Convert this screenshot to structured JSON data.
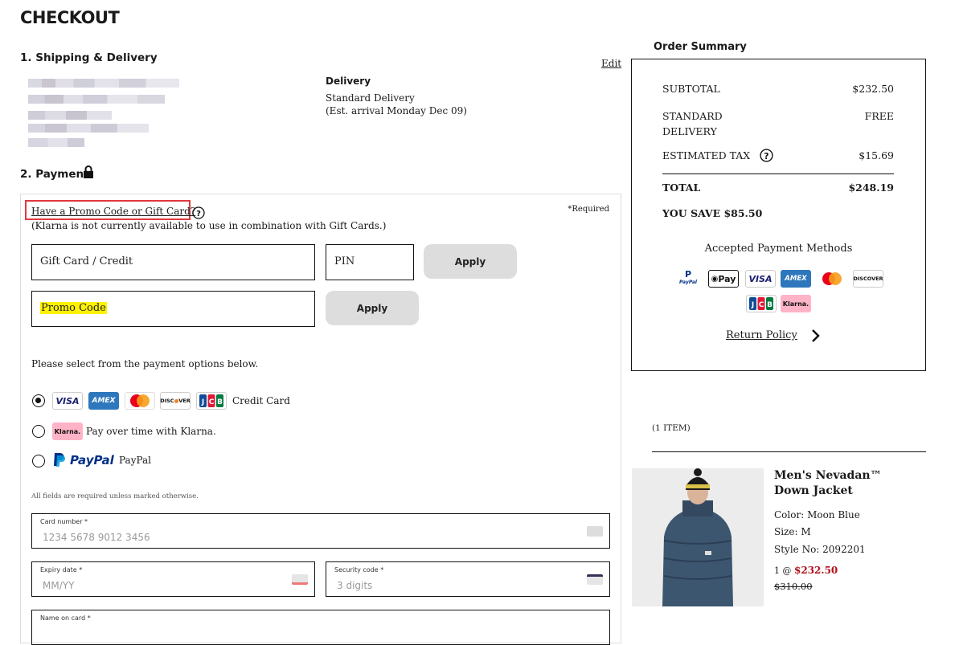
{
  "page": {
    "title": "CHECKOUT"
  },
  "shipping": {
    "heading": "1. Shipping & Delivery",
    "edit_label": "Edit",
    "delivery_heading": "Delivery",
    "delivery_method": "Standard Delivery",
    "delivery_estimate": "(Est. arrival Monday Dec 09)"
  },
  "payment": {
    "heading": "2. Payment",
    "promo_link": "Have a Promo Code or Gift Card?",
    "required_note": "*Required",
    "klarna_note": "(Klarna is not currently available to use in combination with Gift Cards.)",
    "gift_card_placeholder": "Gift Card / Credit",
    "pin_placeholder": "PIN",
    "apply_label": "Apply",
    "promo_placeholder": "Promo Code",
    "select_prompt": "Please select from the payment options below.",
    "options": [
      {
        "label": "Credit Card",
        "selected": true
      },
      {
        "label": "Pay over time with Klarna.",
        "selected": false
      },
      {
        "label": "PayPal",
        "selected": false
      }
    ],
    "paypal_logo_text": "PayPal",
    "fields_note": "All fields are required unless marked otherwise.",
    "card_number": {
      "label": "Card number *",
      "placeholder": "1234 5678 9012 3456"
    },
    "expiry": {
      "label": "Expiry date *",
      "placeholder": "MM/YY"
    },
    "security": {
      "label": "Security code *",
      "placeholder": "3 digits"
    },
    "name_on_card": {
      "label": "Name on card *"
    }
  },
  "summary": {
    "heading": "Order Summary",
    "subtotal_label": "SUBTOTAL",
    "subtotal_value": "$232.50",
    "delivery_label_1": "STANDARD",
    "delivery_label_2": "DELIVERY",
    "delivery_value": "FREE",
    "tax_label": "ESTIMATED TAX",
    "tax_value": "$15.69",
    "total_label": "TOTAL",
    "total_value": "$248.19",
    "save_label": "YOU SAVE $85.50",
    "accepted_heading": "Accepted Payment Methods",
    "return_policy": "Return Policy",
    "logos": [
      "PayPal",
      "Pay",
      "VISA",
      "AMEX",
      "DISCOVER",
      "JCB",
      "Klarna."
    ]
  },
  "cart": {
    "items_count": "(1 ITEM)",
    "product": {
      "name_line1": "Men's Nevadan™",
      "name_line2": "Down Jacket",
      "color": "Color: Moon Blue",
      "size": "Size: M",
      "style": "Style No: 2092201",
      "qty_prefix": "1 @",
      "price": "$232.50",
      "original_price": "$310.00"
    }
  },
  "colors": {
    "accent_red": "#b3101a",
    "highlight": "#fff200",
    "promo_outline": "#e0383e"
  }
}
